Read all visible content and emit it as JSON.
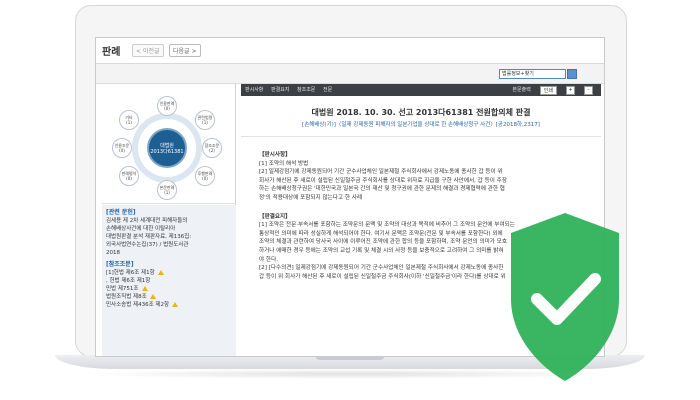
{
  "page": {
    "title": "판례",
    "nav_prev": "< 이전글",
    "nav_next": "다음글 >"
  },
  "search": {
    "placeholder": "법률정보+찾기"
  },
  "diagram": {
    "center": "대법원\n2013다61381",
    "nodes": [
      "인용판례\n(0)",
      "관련법령\n(1)",
      "참조조문\n(2)",
      "후행판례\n(0)",
      "본문판례\n(1)",
      "판례평석\n(0)",
      "인용조문\n(0)",
      "기타\n(1)"
    ]
  },
  "left_sections": [
    {
      "title": "[관련 문헌]",
      "lines": [
        "김세용 제 2차 세계대전 피해자들의",
        "손해배상사건에 대한 이탈리아",
        "대법원판결 분석 재판자료, 제136집:",
        "외국사법연수논집(37) / 법원도서관",
        "2018"
      ]
    },
    {
      "title": "[참조조문]",
      "lines": [
        "[1]헌법 제6조 제1항",
        ", 헌법 제6조 제1항",
        "민법 제751조",
        "법원조직법 제8조",
        "민사소송법 제436조 제2항"
      ]
    }
  ],
  "toolbar": {
    "items": [
      "판시사항",
      "판결요지",
      "참조조문",
      "전문"
    ],
    "right_label": "본문출력",
    "zoom_label": "인쇄",
    "plus": "+",
    "minus": "-"
  },
  "case": {
    "title": "대법원 2018. 10. 30. 선고 2013다61381 전원합의체 판결",
    "subtitle": "[손해배상(기)]〈일제 강제동원 피해자의 일본기업을 상대로 한 손해배상청구 사건〉[공2018하,2317]"
  },
  "body": {
    "sections": [
      {
        "heading": "【판시사항】",
        "lines": [
          "[1] 조약의 해석 방법",
          "[2] 일제강점기에 강제동원되어 기간 군수사업체인 일본제철 주식회사에서 강제노동에 종사한 갑 등이 위",
          "회사가 해산된 후 새로이 설립된 신일철주금 주식회사를 상대로 위자료 지급을 구한 사안에서, 갑 등이 주장",
          "하는 손해배상청구권은 '대한민국과 일본국 간의 재산 및 청구권에 관한 문제의 해결과 경제협력에 관한 협",
          "정'의 적용대상에 포함되지 않는다고 한 사례"
        ]
      },
      {
        "heading": "【판결요지】",
        "lines": [
          "[1] 조약은 전문·부속서를 포함하는 조약문의 문맥 및 조약의 대상과 목적에 비추어 그 조약의 문언에 부여되는",
          "통상적인 의미에 따라 성실하게 해석되어야 한다. 여기서 문맥은 조약문(전문 및 부속서를 포함한다) 외에",
          "조약의 체결과 관련하여 당사국 사이에 이루어진 조약에 관한 합의 등을 포함하며, 조약 문언의 의미가 모호",
          "하거나 애매한 경우 등에는 조약의 교섭 기록 및 체결 시의 사정 등을 보충적으로 고려하여 그 의미를 밝혀",
          "야 한다.",
          "[2] [다수의견] 일제강점기에 강제동원되어 기간 군수사업체인 일본제철 주식회사에서 강제노동에 종사한",
          "갑 등이 위 회사가 해산된 후 새로이 설립된 신일철주금 주식회사(이하 '신일철주금'이라 한다)를 상대로 위"
        ]
      }
    ]
  },
  "colors": {
    "shield": "#2fb25a",
    "shield_check": "#ffffff",
    "accent": "#1b5fa8"
  }
}
